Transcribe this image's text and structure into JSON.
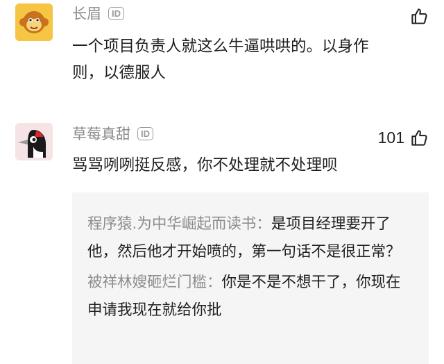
{
  "comments": [
    {
      "username": "长眉",
      "id_badge": "ID",
      "text": "一个项目负责人就这么牛逼哄哄的。以身作则，以德服人",
      "likes": "",
      "avatar_icon": "monkey-avatar-icon"
    },
    {
      "username": "草莓真甜",
      "id_badge": "ID",
      "text": "骂骂咧咧挺反感，你不处理就不处理呗",
      "likes": "101",
      "avatar_icon": "woodpecker-avatar-icon",
      "replies": [
        {
          "name": "程序猿.为中华崛起而读书：",
          "text": "是项目经理要开了他，然后他才开始喷的，第一句话不是很正常？"
        },
        {
          "name": "被祥林嫂砸烂门槛：",
          "text": "你是不是不想干了，你现在申请我现在就给你批"
        }
      ]
    }
  ],
  "colors": {
    "username": "#8a8a8a",
    "reply_background": "#f5f5f5",
    "avatar1_background": "#f6c544",
    "avatar2_background": "#f6e3e6"
  }
}
